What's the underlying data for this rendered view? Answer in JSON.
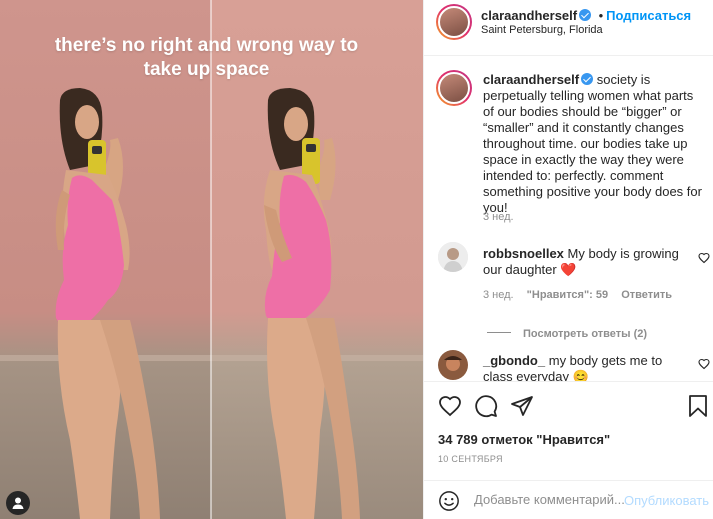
{
  "photo": {
    "caption_line1": "there’s no right and wrong way to",
    "caption_line2": "take up space",
    "user_tag_icon": "user-silhouette-icon"
  },
  "header": {
    "username": "claraandherself",
    "follow_separator": "•",
    "follow_label": "Подписаться",
    "location": "Saint Petersburg, Florida"
  },
  "post": {
    "username": "claraandherself",
    "caption": "society is perpetually telling women what parts of our bodies should be “bigger” or “smaller” and it constantly changes throughout time. our bodies take up space in exactly the way they were intended to: perfectly. comment something positive your body does for you!",
    "age": "3 нед."
  },
  "comments": [
    {
      "username": "robbsnoellex",
      "text": "My body is growing our daughter",
      "emoji": "❤️",
      "age": "3 нед.",
      "likes_label": "\"Нравится\": 59",
      "reply_label": "Ответить",
      "view_replies_label": "Посмотреть ответы (2)"
    },
    {
      "username": "_gbondo_",
      "text": "my body gets me to class everyday",
      "emoji": "😊"
    }
  ],
  "actions": {
    "likes_text": "34 789 отметок \"Нравится\"",
    "date": "10 СЕНТЯБРЯ"
  },
  "add_comment": {
    "placeholder": "Добавьте комментарий...",
    "publish_label": "Опубликовать"
  },
  "colors": {
    "accent": "#0095f6",
    "publish_disabled": "#b3dbff",
    "heart_red": "#ed4956",
    "swimsuit_pink": "#ee6fa6"
  }
}
